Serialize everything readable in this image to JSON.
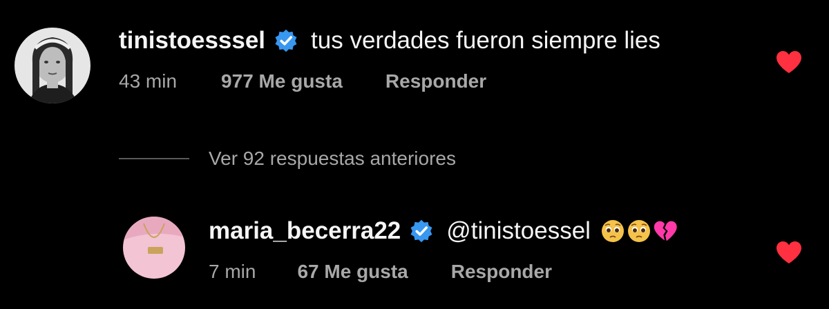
{
  "comments": [
    {
      "username": "tinistoesssel",
      "text": "tus verdades fueron siempre lies",
      "time": "43 min",
      "likes": "977 Me gusta",
      "reply_label": "Responder",
      "verified": true,
      "liked": true
    },
    {
      "username": "maria_becerra22",
      "text": "@tinistoessel",
      "emojis": [
        "pleading-face-icon",
        "pleading-face-icon",
        "broken-heart-icon"
      ],
      "time": "7 min",
      "likes": "67 Me gusta",
      "reply_label": "Responder",
      "verified": true,
      "liked": true
    }
  ],
  "view_more_replies": "Ver 92 respuestas anteriores",
  "colors": {
    "background": "#000000",
    "primary_text": "#f5f5f5",
    "secondary_text": "#a8a8a8",
    "verified_badge": "#3897f0",
    "heart": "#ff3040"
  }
}
